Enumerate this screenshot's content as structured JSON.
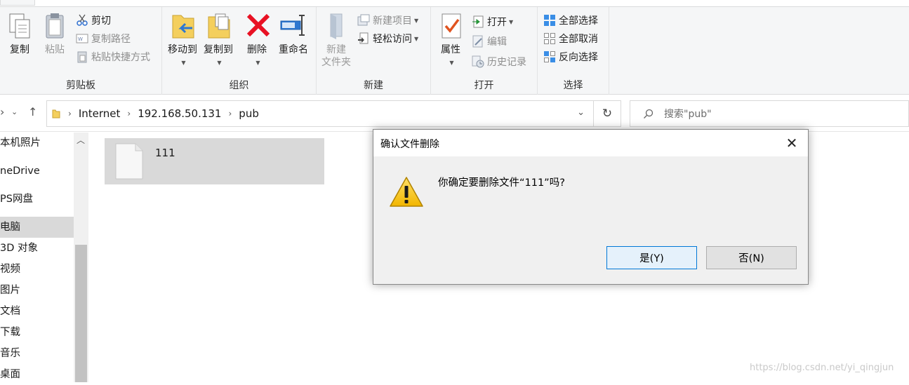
{
  "ribbon": {
    "clipboard": {
      "copy": "复制",
      "paste": "粘贴",
      "cut": "剪切",
      "copy_path": "复制路径",
      "paste_shortcut": "粘贴快捷方式",
      "group_label": "剪贴板"
    },
    "organize": {
      "move_to": "移动到",
      "copy_to": "复制到",
      "delete": "删除",
      "rename": "重命名",
      "group_label": "组织"
    },
    "new": {
      "new_folder_line1": "新建",
      "new_folder_line2": "文件夹",
      "new_item": "新建项目",
      "easy_access": "轻松访问",
      "group_label": "新建"
    },
    "open": {
      "properties": "属性",
      "open": "打开",
      "edit": "编辑",
      "history": "历史记录",
      "group_label": "打开"
    },
    "select": {
      "select_all": "全部选择",
      "select_none": "全部取消",
      "invert": "反向选择",
      "group_label": "选择"
    }
  },
  "address": {
    "crumbs": [
      "Internet",
      "192.168.50.131",
      "pub"
    ],
    "search_placeholder": "搜索\"pub\""
  },
  "nav": {
    "items": [
      "本机照片",
      "neDrive",
      "PS网盘",
      "电脑",
      "3D 对象",
      "视频",
      "图片",
      "文档",
      "下载",
      "音乐",
      "桌面"
    ],
    "selected_index": 3
  },
  "files": [
    {
      "name": "111"
    }
  ],
  "dialog": {
    "title": "确认文件删除",
    "message": "你确定要删除文件“111”吗?",
    "yes_label": "是(Y)",
    "no_label": "否(N)"
  },
  "watermark": "https://blog.csdn.net/yi_qingjun",
  "colors": {
    "ribbon_bg": "#f5f6f7",
    "selection": "#d9d9d9",
    "accent": "#0078d7",
    "delete_red": "#e81123"
  }
}
